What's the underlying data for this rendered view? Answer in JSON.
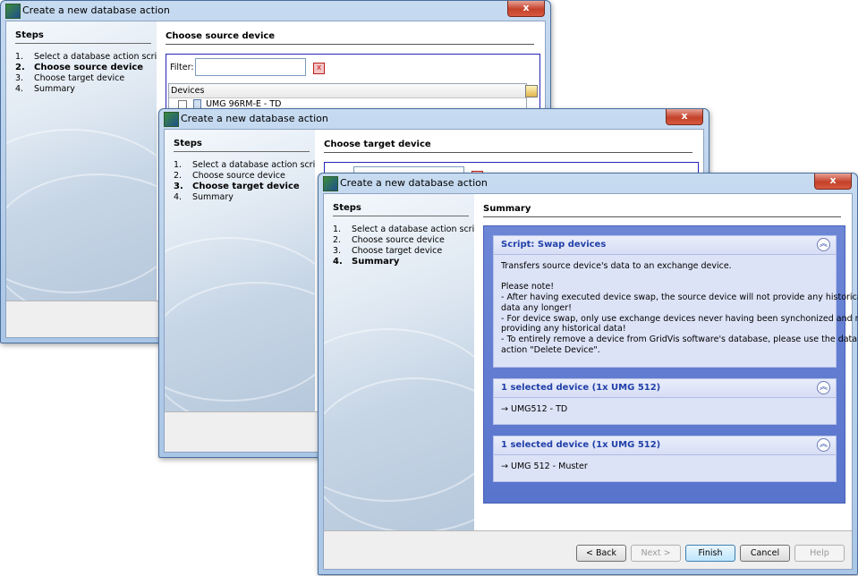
{
  "icons": {
    "app": "gridvis-app-icon",
    "close": "close-icon",
    "clear": "clear-filter-icon",
    "collapse": "collapse-icon",
    "column_chooser": "column-chooser-icon",
    "checkbox": "checkbox-icon",
    "device": "device-icon",
    "arrow": "arrow-icon"
  },
  "windows": [
    {
      "title": "Create a new database action",
      "close_label": "x",
      "steps_title": "Steps",
      "steps": [
        {
          "num": "1.",
          "label": "Select a database action script"
        },
        {
          "num": "2.",
          "label": "Choose source device"
        },
        {
          "num": "3.",
          "label": "Choose target device"
        },
        {
          "num": "4.",
          "label": "Summary"
        }
      ],
      "content_title": "Choose source device",
      "filter_label": "Filter:",
      "filter_value": "",
      "clear_label": "x",
      "devices_header": "Devices",
      "device_row": "UMG 96RM-E - TD"
    },
    {
      "title": "Create a new database action",
      "close_label": "x",
      "steps_title": "Steps",
      "steps": [
        {
          "num": "1.",
          "label": "Select a database action script"
        },
        {
          "num": "2.",
          "label": "Choose source device"
        },
        {
          "num": "3.",
          "label": "Choose target device"
        },
        {
          "num": "4.",
          "label": "Summary"
        }
      ],
      "content_title": "Choose target device"
    },
    {
      "title": "Create a new database action",
      "close_label": "x",
      "steps_title": "Steps",
      "steps": [
        {
          "num": "1.",
          "label": "Select a database action script"
        },
        {
          "num": "2.",
          "label": "Choose source device"
        },
        {
          "num": "3.",
          "label": "Choose target device"
        },
        {
          "num": "4.",
          "label": "Summary"
        }
      ],
      "content_title": "Summary",
      "summary": {
        "script_title": "Script: Swap devices",
        "description": "Transfers source device's data to an exchange device.",
        "note_heading": "Please note!",
        "note_lines": [
          "- After having executed device swap, the source device will not provide any historical",
          "data any longer!",
          "- For device swap, only use exchange devices never having been synchonized and not",
          "providing any historical data!",
          "- To entirely remove a device from GridVis software's database, please use the database",
          "action \"Delete Device\"."
        ],
        "source_title": "1 selected device (1x UMG 512)",
        "source_device": "UMG512 - TD",
        "target_title": "1 selected device (1x UMG 512)",
        "target_device": "UMG 512 - Muster",
        "collapse_label": "︽",
        "arrow_label": "→"
      },
      "buttons": {
        "back": "< Back",
        "next": "Next >",
        "finish": "Finish",
        "cancel": "Cancel",
        "help": "Help"
      }
    }
  ]
}
